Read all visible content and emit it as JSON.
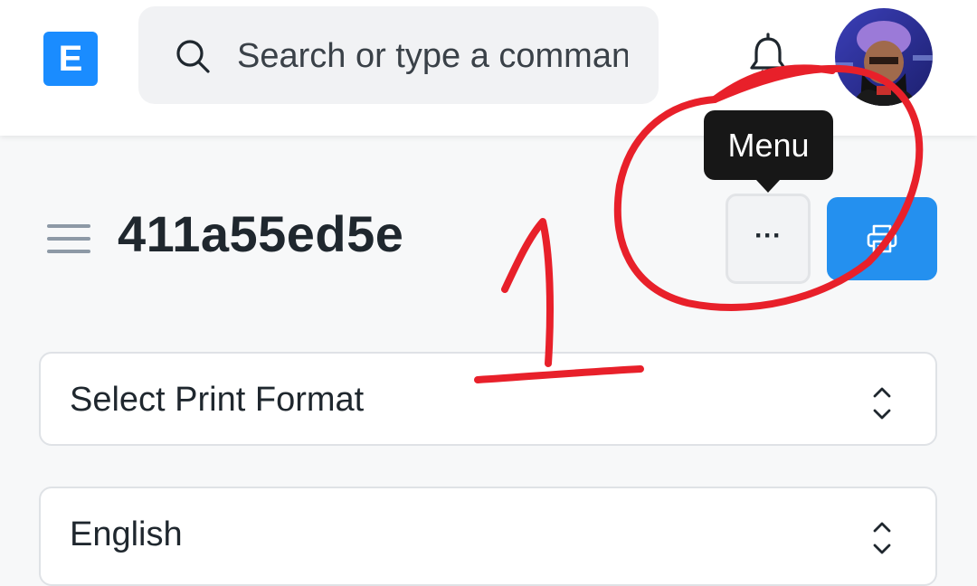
{
  "header": {
    "logo_letter": "E",
    "search_placeholder": "Search or type a command (Ctrl + G)"
  },
  "page": {
    "title": "411a55ed5e"
  },
  "toolbar": {
    "tooltip_text": "Menu",
    "menu_label": "···"
  },
  "fields": {
    "print_format": "Select Print Format",
    "language": "English"
  },
  "colors": {
    "brand": "#1a8cff",
    "primary_button": "#2490ef",
    "annotation": "#e8202a"
  }
}
